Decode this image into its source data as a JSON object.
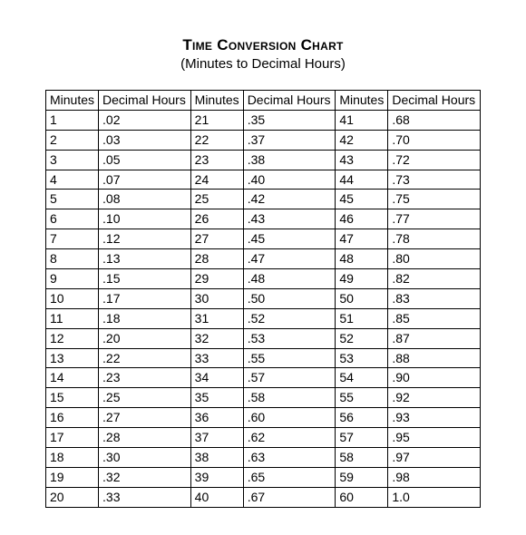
{
  "title": "Time Conversion Chart",
  "subtitle": "(Minutes to Decimal Hours)",
  "headers": {
    "minutes": "Minutes",
    "decimal": "Decimal Hours"
  },
  "chart_data": {
    "type": "table",
    "columns": [
      "Minutes",
      "Decimal Hours"
    ],
    "rows": [
      [
        1,
        ".02"
      ],
      [
        2,
        ".03"
      ],
      [
        3,
        ".05"
      ],
      [
        4,
        ".07"
      ],
      [
        5,
        ".08"
      ],
      [
        6,
        ".10"
      ],
      [
        7,
        ".12"
      ],
      [
        8,
        ".13"
      ],
      [
        9,
        ".15"
      ],
      [
        10,
        ".17"
      ],
      [
        11,
        ".18"
      ],
      [
        12,
        ".20"
      ],
      [
        13,
        ".22"
      ],
      [
        14,
        ".23"
      ],
      [
        15,
        ".25"
      ],
      [
        16,
        ".27"
      ],
      [
        17,
        ".28"
      ],
      [
        18,
        ".30"
      ],
      [
        19,
        ".32"
      ],
      [
        20,
        ".33"
      ],
      [
        21,
        ".35"
      ],
      [
        22,
        ".37"
      ],
      [
        23,
        ".38"
      ],
      [
        24,
        ".40"
      ],
      [
        25,
        ".42"
      ],
      [
        26,
        ".43"
      ],
      [
        27,
        ".45"
      ],
      [
        28,
        ".47"
      ],
      [
        29,
        ".48"
      ],
      [
        30,
        ".50"
      ],
      [
        31,
        ".52"
      ],
      [
        32,
        ".53"
      ],
      [
        33,
        ".55"
      ],
      [
        34,
        ".57"
      ],
      [
        35,
        ".58"
      ],
      [
        36,
        ".60"
      ],
      [
        37,
        ".62"
      ],
      [
        38,
        ".63"
      ],
      [
        39,
        ".65"
      ],
      [
        40,
        ".67"
      ],
      [
        41,
        ".68"
      ],
      [
        42,
        ".70"
      ],
      [
        43,
        ".72"
      ],
      [
        44,
        ".73"
      ],
      [
        45,
        ".75"
      ],
      [
        46,
        ".77"
      ],
      [
        47,
        ".78"
      ],
      [
        48,
        ".80"
      ],
      [
        49,
        ".82"
      ],
      [
        50,
        ".83"
      ],
      [
        51,
        ".85"
      ],
      [
        52,
        ".87"
      ],
      [
        53,
        ".88"
      ],
      [
        54,
        ".90"
      ],
      [
        55,
        ".92"
      ],
      [
        56,
        ".93"
      ],
      [
        57,
        ".95"
      ],
      [
        58,
        ".97"
      ],
      [
        59,
        ".98"
      ],
      [
        60,
        "1.0"
      ]
    ]
  }
}
